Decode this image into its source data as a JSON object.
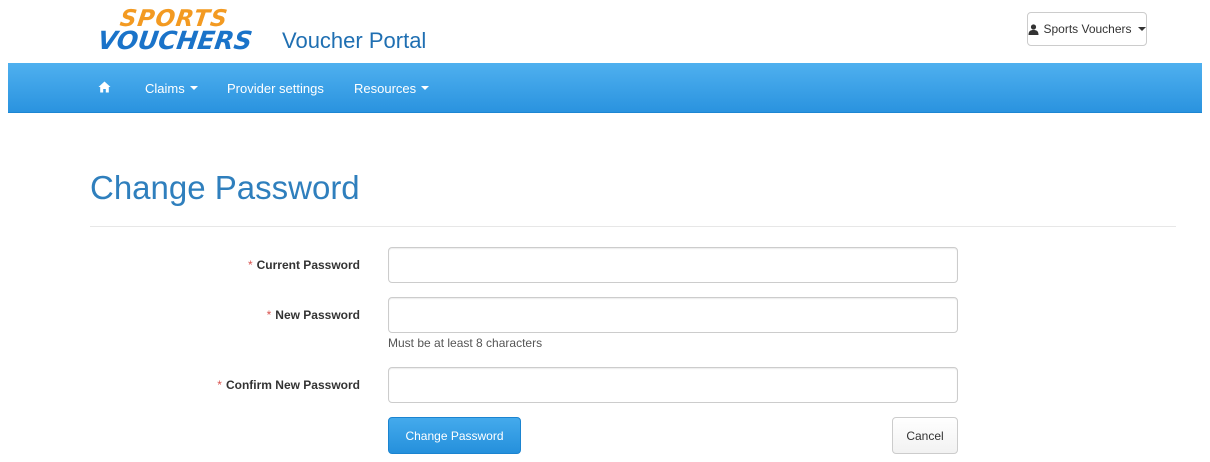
{
  "header": {
    "logo_top": "SPORTS",
    "logo_bottom": "VOUCHERS",
    "portal_title": "Voucher Portal",
    "user_menu_label": "Sports Vouchers"
  },
  "nav": {
    "home_icon": "home-icon",
    "claims_label": "Claims",
    "provider_settings_label": "Provider settings",
    "resources_label": "Resources"
  },
  "page": {
    "title": "Change Password"
  },
  "form": {
    "required_marker": "*",
    "current_password_label": "Current Password",
    "current_password_value": "",
    "new_password_label": "New Password",
    "new_password_value": "",
    "new_password_help": "Must be at least 8 characters",
    "confirm_password_label": "Confirm New Password",
    "confirm_password_value": "",
    "submit_label": "Change Password",
    "cancel_label": "Cancel"
  },
  "colors": {
    "navbar": "#2f9be3",
    "title": "#2f7fbd",
    "primary_button": "#2f9be3",
    "required": "#d9534f",
    "logo_orange": "#f39a21",
    "logo_blue": "#1a73c9"
  }
}
